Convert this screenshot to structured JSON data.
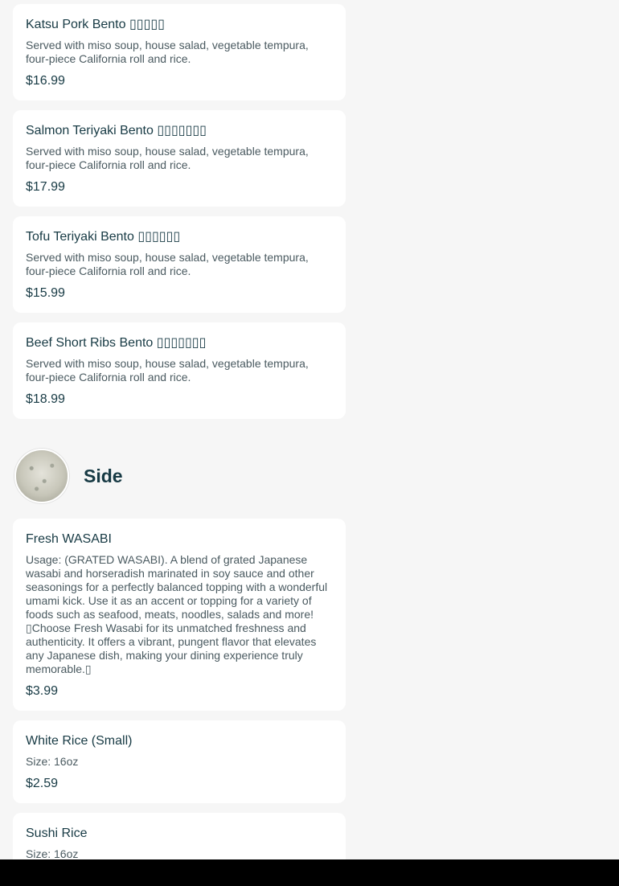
{
  "bento_items": [
    {
      "name": "Katsu Pork Bento ▯▯▯▯▯",
      "description": "Served with miso soup, house salad, vegetable tempura, four-piece California roll and rice.",
      "price": "$16.99"
    },
    {
      "name": "Salmon Teriyaki Bento ▯▯▯▯▯▯▯",
      "description": "Served with miso soup, house salad, vegetable tempura, four-piece California roll and rice.",
      "price": "$17.99"
    },
    {
      "name": "Tofu Teriyaki Bento ▯▯▯▯▯▯",
      "description": "Served with miso soup, house salad, vegetable tempura, four-piece California roll and rice.",
      "price": "$15.99"
    },
    {
      "name": "Beef Short Ribs Bento ▯▯▯▯▯▯▯",
      "description": "Served with miso soup, house salad, vegetable tempura, four-piece California roll and rice.",
      "price": "$18.99"
    }
  ],
  "side_section": {
    "title": "Side",
    "image_icon": "rice-bowl-photo"
  },
  "side_items": [
    {
      "name": "Fresh WASABI",
      "description": "Usage: (GRATED WASABI). A blend of grated Japanese wasabi and horseradish marinated in soy sauce and other seasonings for a perfectly balanced topping with a wonderful umami kick. Use it as an accent or topping for a variety of foods such as seafood, meats, noodles, salads and more! ▯Choose Fresh Wasabi for its unmatched freshness and authenticity. It offers a vibrant, pungent flavor that elevates any Japanese dish, making your dining experience truly memorable.▯",
      "price": "$3.99"
    },
    {
      "name": "White Rice (Small)",
      "description": "Size: 16oz",
      "price": "$2.59"
    },
    {
      "name": "Sushi Rice",
      "description": "Size: 16oz",
      "price": ""
    }
  ],
  "colors": {
    "background": "#f6f6f6",
    "card": "#ffffff",
    "text_primary": "#173a44",
    "text_secondary": "#4a5a60"
  }
}
